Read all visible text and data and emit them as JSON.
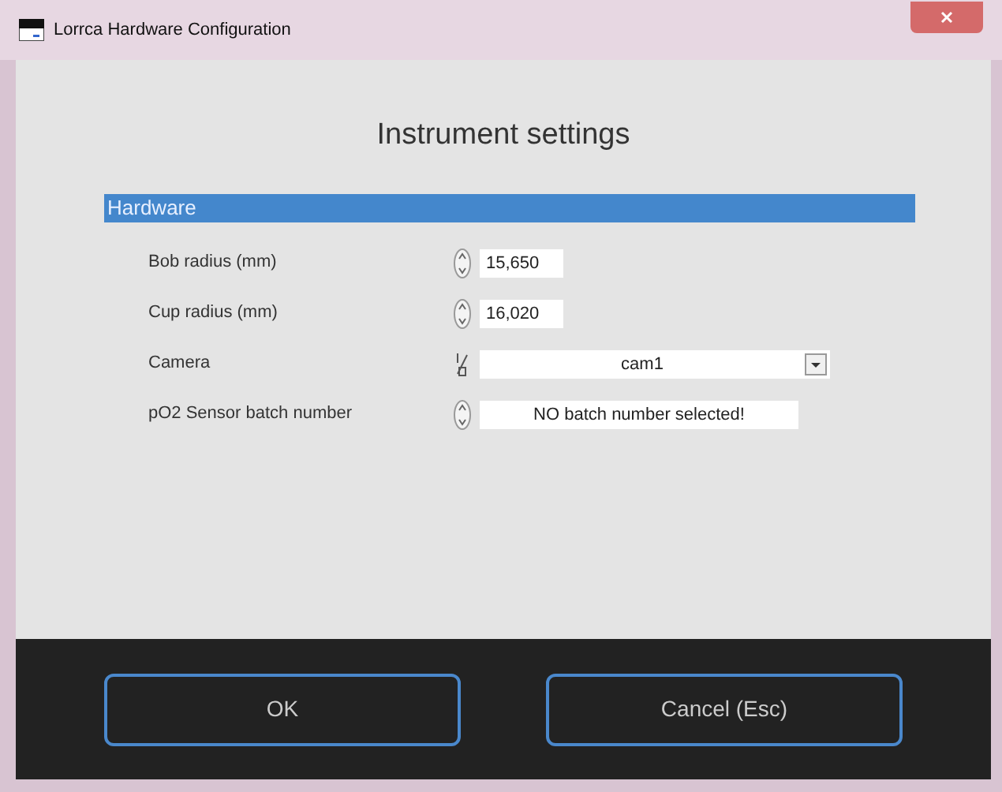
{
  "window": {
    "title": "Lorrca Hardware Configuration"
  },
  "heading": "Instrument settings",
  "section": {
    "title": "Hardware"
  },
  "fields": [
    {
      "label": "Bob radius (mm)",
      "kind": "spin",
      "value": "15,650"
    },
    {
      "label": "Cup radius (mm)",
      "kind": "spin",
      "value": "16,020"
    },
    {
      "label": "Camera",
      "kind": "combo",
      "value": "cam1"
    },
    {
      "label": "pO2 Sensor batch number",
      "kind": "spinwide",
      "value": "NO batch number selected!"
    }
  ],
  "buttons": [
    "OK",
    "Cancel (Esc)"
  ]
}
